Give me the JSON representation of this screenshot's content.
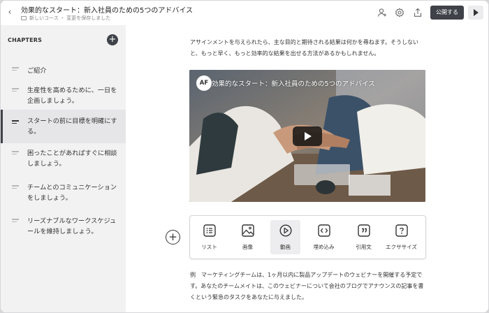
{
  "header": {
    "course_title": "効果的なスタート：新入社員のための5つのアドバイス",
    "breadcrumb": "新しいコース",
    "save_status": "変更を保存しました",
    "publish_label": "公開する"
  },
  "sidebar": {
    "heading": "CHAPTERS",
    "add_symbol": "+",
    "chapters": [
      {
        "label": "ご紹介",
        "active": false
      },
      {
        "label": "生産性を高めるために、一日を企画しましょう。",
        "active": false
      },
      {
        "label": "スタートの前に目標を明確にする。",
        "active": true
      },
      {
        "label": "困ったことがあればすぐに相談しましょう。",
        "active": false
      },
      {
        "label": "チームとのコミュニケーションをしましょう。",
        "active": false
      },
      {
        "label": "リーズナブルなワークスケジュールを維持しましょう。",
        "active": false
      }
    ]
  },
  "content": {
    "intro_text": "アサインメントを与えられたら、主な目的と期待される結果は何かを尋ねます。そうしないと、もっと早く、もっと効率的な結果を出せる方法があるかもしれません。",
    "video": {
      "channel_initials": "AF",
      "title": "効果的なスタート：新入社員のための5つのアドバイス"
    },
    "insert_symbol": "+",
    "toolbar": [
      {
        "label": "リスト",
        "icon": "list-icon",
        "highlighted": false
      },
      {
        "label": "画像",
        "icon": "image-icon",
        "highlighted": false
      },
      {
        "label": "動画",
        "icon": "video-play-icon",
        "highlighted": true
      },
      {
        "label": "埋め込み",
        "icon": "embed-icon",
        "highlighted": false
      },
      {
        "label": "引用文",
        "icon": "quote-icon",
        "highlighted": false
      },
      {
        "label": "エクササイズ",
        "icon": "exercise-icon",
        "highlighted": false
      }
    ],
    "example_text": "例　マーケティングチームは、1ヶ月以内に製品アップデートのウェビナーを開催する予定です。あなたのチームメイトは、このウェビナーについて会社のブログでアナウンスの記事を書くという緊急のタスクをあなたに与えました。"
  },
  "colors": {
    "accent_dark": "#3f4248",
    "sidebar_bg": "#f2f2f3"
  }
}
